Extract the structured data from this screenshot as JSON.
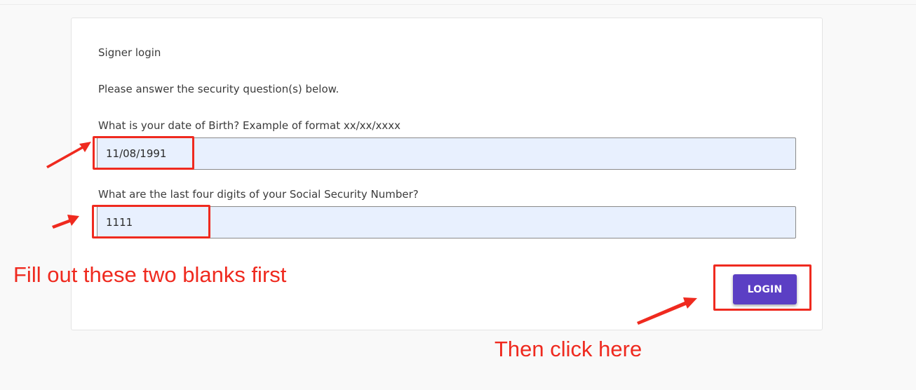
{
  "form": {
    "heading": "Signer login",
    "instruction": "Please answer the security question(s) below.",
    "dob": {
      "label": "What is your date of Birth? Example of format xx/xx/xxxx",
      "value": "11/08/1991"
    },
    "ssn": {
      "label": "What are the last four digits of your Social Security Number?",
      "value": "1111"
    },
    "login_label": "LOGIN"
  },
  "annotations": {
    "fill_text": "Fill out these two blanks first",
    "click_text": "Then click here",
    "color": "#ef2a1f"
  },
  "colors": {
    "button": "#5b3fc4",
    "field_bg": "#e8f0fe",
    "page_bg": "#f9f9f9"
  }
}
